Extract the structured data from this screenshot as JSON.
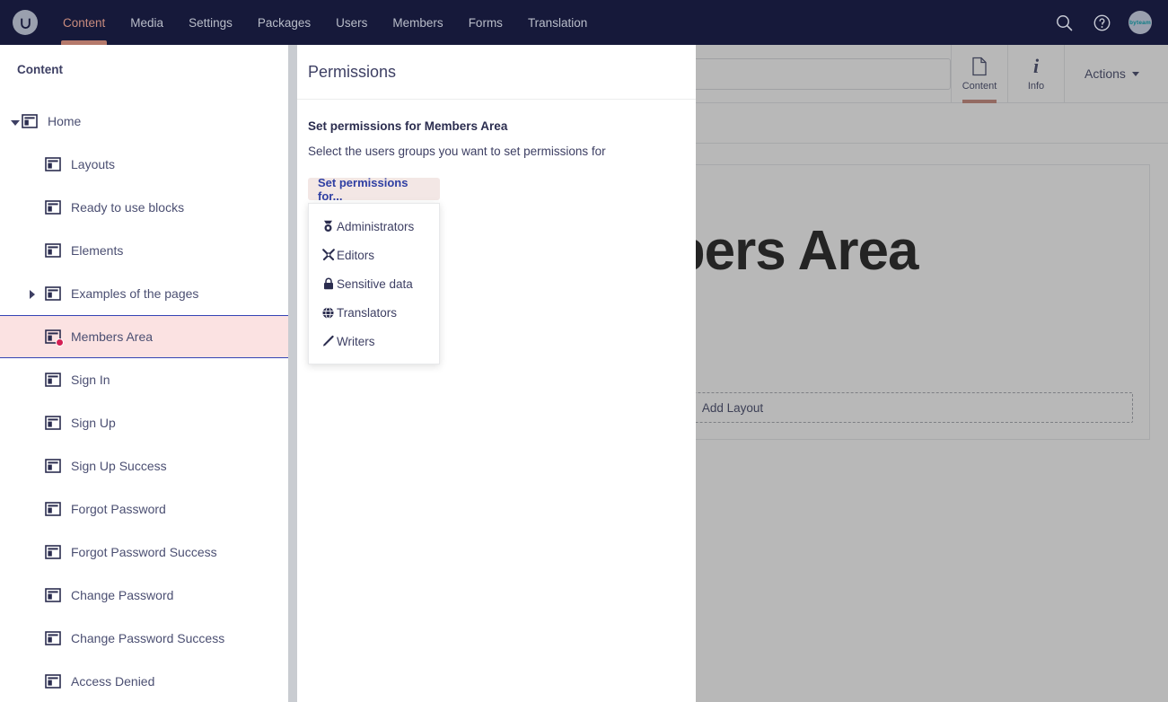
{
  "topnav": {
    "logo_icon": "umbraco-logo-icon",
    "items": [
      {
        "label": "Content",
        "active": true
      },
      {
        "label": "Media",
        "active": false
      },
      {
        "label": "Settings",
        "active": false
      },
      {
        "label": "Packages",
        "active": false
      },
      {
        "label": "Users",
        "active": false
      },
      {
        "label": "Members",
        "active": false
      },
      {
        "label": "Forms",
        "active": false
      },
      {
        "label": "Translation",
        "active": false
      }
    ],
    "search_icon": "search-icon",
    "help_icon": "help-icon",
    "avatar_label": "byteam",
    "accent_color": "#b5796b",
    "background_color": "#16193a"
  },
  "sidebar": {
    "title": "Content",
    "selected_color": "#fbe2e2",
    "selected_border_color": "#3544b4",
    "items": [
      {
        "label": "Home",
        "level": "root",
        "caret": "open",
        "selected": false,
        "badge": false
      },
      {
        "label": "Layouts",
        "level": "child",
        "caret": "none",
        "selected": false,
        "badge": false
      },
      {
        "label": "Ready to use blocks",
        "level": "child",
        "caret": "none",
        "selected": false,
        "badge": false
      },
      {
        "label": "Elements",
        "level": "child",
        "caret": "none",
        "selected": false,
        "badge": false
      },
      {
        "label": "Examples of the pages",
        "level": "child",
        "caret": "closed",
        "selected": false,
        "badge": false
      },
      {
        "label": "Members Area",
        "level": "child",
        "caret": "none",
        "selected": true,
        "badge": true
      },
      {
        "label": "Sign In",
        "level": "child",
        "caret": "none",
        "selected": false,
        "badge": false
      },
      {
        "label": "Sign Up",
        "level": "child",
        "caret": "none",
        "selected": false,
        "badge": false
      },
      {
        "label": "Sign Up Success",
        "level": "child",
        "caret": "none",
        "selected": false,
        "badge": false
      },
      {
        "label": "Forgot Password",
        "level": "child",
        "caret": "none",
        "selected": false,
        "badge": false
      },
      {
        "label": "Forgot Password Success",
        "level": "child",
        "caret": "none",
        "selected": false,
        "badge": false
      },
      {
        "label": "Change Password",
        "level": "child",
        "caret": "none",
        "selected": false,
        "badge": false
      },
      {
        "label": "Change Password Success",
        "level": "child",
        "caret": "none",
        "selected": false,
        "badge": false
      },
      {
        "label": "Access Denied",
        "level": "child",
        "caret": "none",
        "selected": false,
        "badge": false
      }
    ]
  },
  "editor": {
    "name_value": "",
    "name_placeholder": "",
    "tabs": [
      {
        "label": "Content",
        "icon": "document-icon",
        "active": true
      },
      {
        "label": "Info",
        "icon": "info-icon",
        "active": false
      }
    ],
    "actions_label": "Actions",
    "hero_title": "Members Area",
    "add_layout_label": "Add Layout"
  },
  "overlay": {
    "title": "Permissions",
    "heading": "Set permissions for Members Area",
    "subheading": "Select the users groups you want to set permissions for",
    "dropdown": {
      "button_label": "Set permissions for...",
      "button_bg": "#f3e7e5",
      "button_text_color": "#2f3fa3",
      "open": true,
      "options": [
        {
          "label": "Administrators",
          "icon": "medal-icon"
        },
        {
          "label": "Editors",
          "icon": "tools-icon"
        },
        {
          "label": "Sensitive data",
          "icon": "lock-icon"
        },
        {
          "label": "Translators",
          "icon": "globe-icon"
        },
        {
          "label": "Writers",
          "icon": "pen-icon"
        }
      ]
    }
  }
}
